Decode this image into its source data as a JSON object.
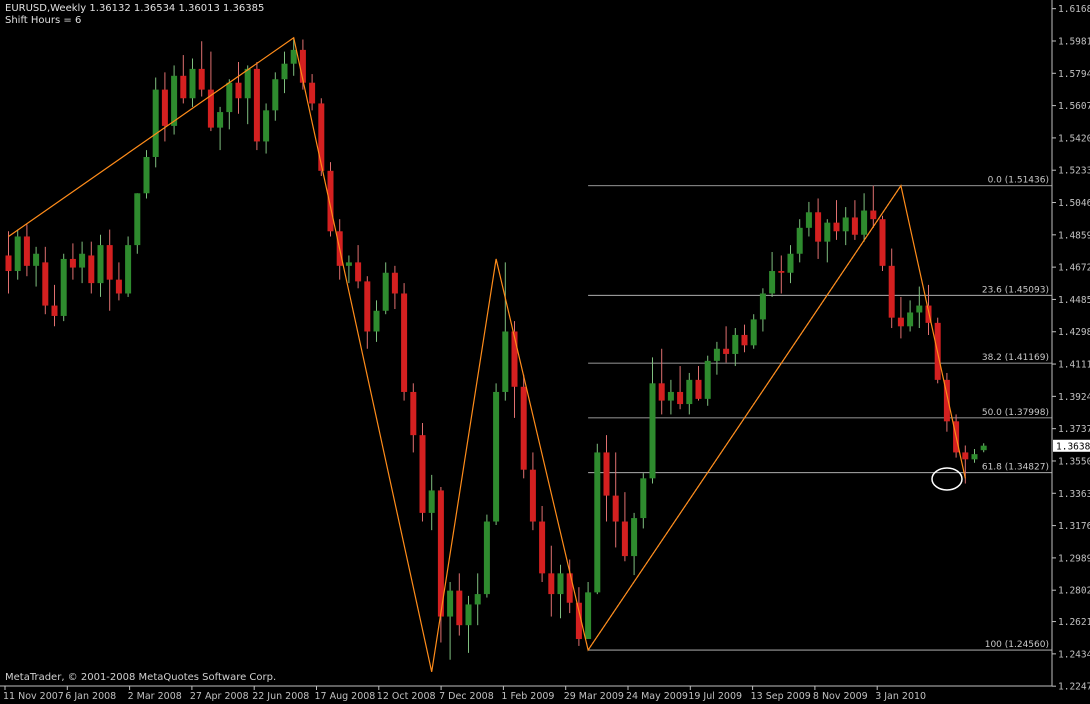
{
  "header": {
    "symbol_line": "EURUSD,Weekly  1.36132 1.36534 1.36013 1.36385",
    "shift_line": "Shift Hours = 6"
  },
  "footer": {
    "copyright": "MetaTrader, © 2001-2008 MetaQuotes Software Corp."
  },
  "colors": {
    "background": "#000000",
    "axis": "#c0c0c0",
    "bull": "#2e8b2e",
    "bear": "#d42020",
    "zigzag": "#ff8c1a",
    "fib": "#c8c8c8",
    "text": "#d0d0d0"
  },
  "chart_data": {
    "type": "candlestick",
    "symbol": "EURUSD",
    "timeframe": "Weekly",
    "ylim": [
      1.2248,
      1.6184
    ],
    "price_ticks": [
      "1.61685",
      "1.59815",
      "1.57945",
      "1.56075",
      "1.54205",
      "1.52335",
      "1.50465",
      "1.48595",
      "1.46725",
      "1.44855",
      "1.42985",
      "1.41115",
      "1.39245",
      "1.37375",
      "1.35505",
      "1.33635",
      "1.31765",
      "1.29895",
      "1.28025",
      "1.26210",
      "1.24340",
      "1.22470"
    ],
    "current_price": "1.36385",
    "date_ticks": [
      "11 Nov 2007",
      "6 Jan 2008",
      "2 Mar 2008",
      "27 Apr 2008",
      "22 Jun 2008",
      "17 Aug 2008",
      "12 Oct 2008",
      "7 Dec 2008",
      "1 Feb 2009",
      "29 Mar 2009",
      "24 May 2009",
      "19 Jul 2009",
      "13 Sep 2009",
      "8 Nov 2009",
      "3 Jan 2010"
    ],
    "candles": [
      [
        1.474,
        1.488,
        1.452,
        1.465
      ],
      [
        1.465,
        1.489,
        1.46,
        1.485
      ],
      [
        1.485,
        1.492,
        1.462,
        1.468
      ],
      [
        1.468,
        1.479,
        1.456,
        1.475
      ],
      [
        1.47,
        1.479,
        1.44,
        1.445
      ],
      [
        1.445,
        1.457,
        1.433,
        1.439
      ],
      [
        1.439,
        1.475,
        1.436,
        1.472
      ],
      [
        1.472,
        1.481,
        1.46,
        1.467
      ],
      [
        1.467,
        1.482,
        1.458,
        1.475
      ],
      [
        1.474,
        1.482,
        1.452,
        1.458
      ],
      [
        1.458,
        1.486,
        1.45,
        1.48
      ],
      [
        1.48,
        1.489,
        1.442,
        1.46
      ],
      [
        1.46,
        1.47,
        1.448,
        1.452
      ],
      [
        1.452,
        1.485,
        1.45,
        1.48
      ],
      [
        1.48,
        1.51,
        1.475,
        1.51
      ],
      [
        1.51,
        1.535,
        1.507,
        1.531
      ],
      [
        1.531,
        1.577,
        1.525,
        1.57
      ],
      [
        1.57,
        1.58,
        1.54,
        1.549
      ],
      [
        1.549,
        1.584,
        1.544,
        1.578
      ],
      [
        1.578,
        1.59,
        1.562,
        1.565
      ],
      [
        1.565,
        1.588,
        1.56,
        1.582
      ],
      [
        1.582,
        1.598,
        1.566,
        1.57
      ],
      [
        1.57,
        1.592,
        1.546,
        1.548
      ],
      [
        1.548,
        1.56,
        1.535,
        1.557
      ],
      [
        1.557,
        1.576,
        1.547,
        1.574
      ],
      [
        1.574,
        1.586,
        1.556,
        1.565
      ],
      [
        1.565,
        1.584,
        1.55,
        1.582
      ],
      [
        1.582,
        1.586,
        1.535,
        1.54
      ],
      [
        1.54,
        1.562,
        1.533,
        1.558
      ],
      [
        1.558,
        1.58,
        1.552,
        1.576
      ],
      [
        1.576,
        1.592,
        1.568,
        1.585
      ],
      [
        1.585,
        1.6,
        1.578,
        1.593
      ],
      [
        1.593,
        1.599,
        1.57,
        1.574
      ],
      [
        1.574,
        1.579,
        1.558,
        1.562
      ],
      [
        1.562,
        1.565,
        1.52,
        1.523
      ],
      [
        1.523,
        1.528,
        1.485,
        1.488
      ],
      [
        1.488,
        1.495,
        1.46,
        1.468
      ],
      [
        1.468,
        1.474,
        1.458,
        1.47
      ],
      [
        1.47,
        1.48,
        1.455,
        1.459
      ],
      [
        1.459,
        1.462,
        1.42,
        1.43
      ],
      [
        1.43,
        1.448,
        1.424,
        1.442
      ],
      [
        1.442,
        1.47,
        1.44,
        1.464
      ],
      [
        1.464,
        1.468,
        1.443,
        1.452
      ],
      [
        1.452,
        1.458,
        1.39,
        1.395
      ],
      [
        1.395,
        1.4,
        1.36,
        1.37
      ],
      [
        1.37,
        1.377,
        1.32,
        1.325
      ],
      [
        1.325,
        1.347,
        1.315,
        1.338
      ],
      [
        1.338,
        1.34,
        1.25,
        1.265
      ],
      [
        1.265,
        1.285,
        1.24,
        1.28
      ],
      [
        1.28,
        1.29,
        1.254,
        1.26
      ],
      [
        1.26,
        1.277,
        1.244,
        1.272
      ],
      [
        1.272,
        1.29,
        1.26,
        1.278
      ],
      [
        1.278,
        1.324,
        1.276,
        1.32
      ],
      [
        1.32,
        1.4,
        1.318,
        1.395
      ],
      [
        1.395,
        1.47,
        1.39,
        1.43
      ],
      [
        1.43,
        1.436,
        1.38,
        1.398
      ],
      [
        1.398,
        1.405,
        1.345,
        1.35
      ],
      [
        1.35,
        1.36,
        1.315,
        1.32
      ],
      [
        1.32,
        1.329,
        1.285,
        1.29
      ],
      [
        1.29,
        1.306,
        1.265,
        1.278
      ],
      [
        1.278,
        1.295,
        1.264,
        1.29
      ],
      [
        1.29,
        1.298,
        1.267,
        1.273
      ],
      [
        1.273,
        1.282,
        1.248,
        1.252
      ],
      [
        1.252,
        1.285,
        1.252,
        1.279
      ],
      [
        1.279,
        1.365,
        1.278,
        1.36
      ],
      [
        1.36,
        1.37,
        1.32,
        1.335
      ],
      [
        1.335,
        1.36,
        1.305,
        1.32
      ],
      [
        1.32,
        1.337,
        1.297,
        1.3
      ],
      [
        1.3,
        1.325,
        1.289,
        1.322
      ],
      [
        1.322,
        1.348,
        1.316,
        1.345
      ],
      [
        1.345,
        1.415,
        1.342,
        1.4
      ],
      [
        1.4,
        1.42,
        1.382,
        1.39
      ],
      [
        1.39,
        1.402,
        1.382,
        1.395
      ],
      [
        1.395,
        1.41,
        1.385,
        1.388
      ],
      [
        1.388,
        1.406,
        1.382,
        1.402
      ],
      [
        1.402,
        1.41,
        1.39,
        1.391
      ],
      [
        1.391,
        1.416,
        1.387,
        1.413
      ],
      [
        1.413,
        1.424,
        1.405,
        1.42
      ],
      [
        1.42,
        1.433,
        1.412,
        1.417
      ],
      [
        1.417,
        1.432,
        1.41,
        1.428
      ],
      [
        1.428,
        1.434,
        1.418,
        1.422
      ],
      [
        1.422,
        1.44,
        1.42,
        1.437
      ],
      [
        1.437,
        1.455,
        1.43,
        1.452
      ],
      [
        1.452,
        1.476,
        1.45,
        1.465
      ],
      [
        1.465,
        1.474,
        1.452,
        1.464
      ],
      [
        1.464,
        1.48,
        1.458,
        1.475
      ],
      [
        1.475,
        1.495,
        1.47,
        1.49
      ],
      [
        1.49,
        1.505,
        1.485,
        1.499
      ],
      [
        1.499,
        1.507,
        1.472,
        1.482
      ],
      [
        1.482,
        1.495,
        1.47,
        1.493
      ],
      [
        1.493,
        1.506,
        1.483,
        1.488
      ],
      [
        1.488,
        1.502,
        1.48,
        1.496
      ],
      [
        1.496,
        1.506,
        1.483,
        1.486
      ],
      [
        1.486,
        1.51,
        1.482,
        1.5
      ],
      [
        1.5,
        1.5144,
        1.49,
        1.495
      ],
      [
        1.495,
        1.497,
        1.465,
        1.468
      ],
      [
        1.468,
        1.478,
        1.432,
        1.438
      ],
      [
        1.438,
        1.45,
        1.426,
        1.433
      ],
      [
        1.433,
        1.448,
        1.43,
        1.441
      ],
      [
        1.441,
        1.456,
        1.432,
        1.445
      ],
      [
        1.445,
        1.457,
        1.428,
        1.435
      ],
      [
        1.435,
        1.438,
        1.4,
        1.402
      ],
      [
        1.402,
        1.406,
        1.372,
        1.378
      ],
      [
        1.378,
        1.382,
        1.357,
        1.36
      ],
      [
        1.36,
        1.364,
        1.342,
        1.356
      ],
      [
        1.356,
        1.362,
        1.354,
        1.359
      ],
      [
        1.3613,
        1.3653,
        1.3601,
        1.3639
      ]
    ],
    "zigzag": [
      [
        1.485,
        0
      ],
      [
        1.6,
        31
      ],
      [
        1.233,
        46
      ],
      [
        1.472,
        53
      ],
      [
        1.2456,
        63
      ],
      [
        1.5144,
        97
      ],
      [
        1.345,
        104
      ]
    ],
    "fibonacci": [
      {
        "label": "0.0 (1.51436)",
        "price": 1.51436
      },
      {
        "label": "23.6 (1.45093)",
        "price": 1.45093
      },
      {
        "label": "38.2 (1.41169)",
        "price": 1.41169
      },
      {
        "label": "50.0 (1.37998)",
        "price": 1.37998
      },
      {
        "label": "61.8 (1.34827)",
        "price": 1.34827
      },
      {
        "label": "100 (1.24560)",
        "price": 1.2456
      }
    ],
    "fib_start_bar": 63
  }
}
